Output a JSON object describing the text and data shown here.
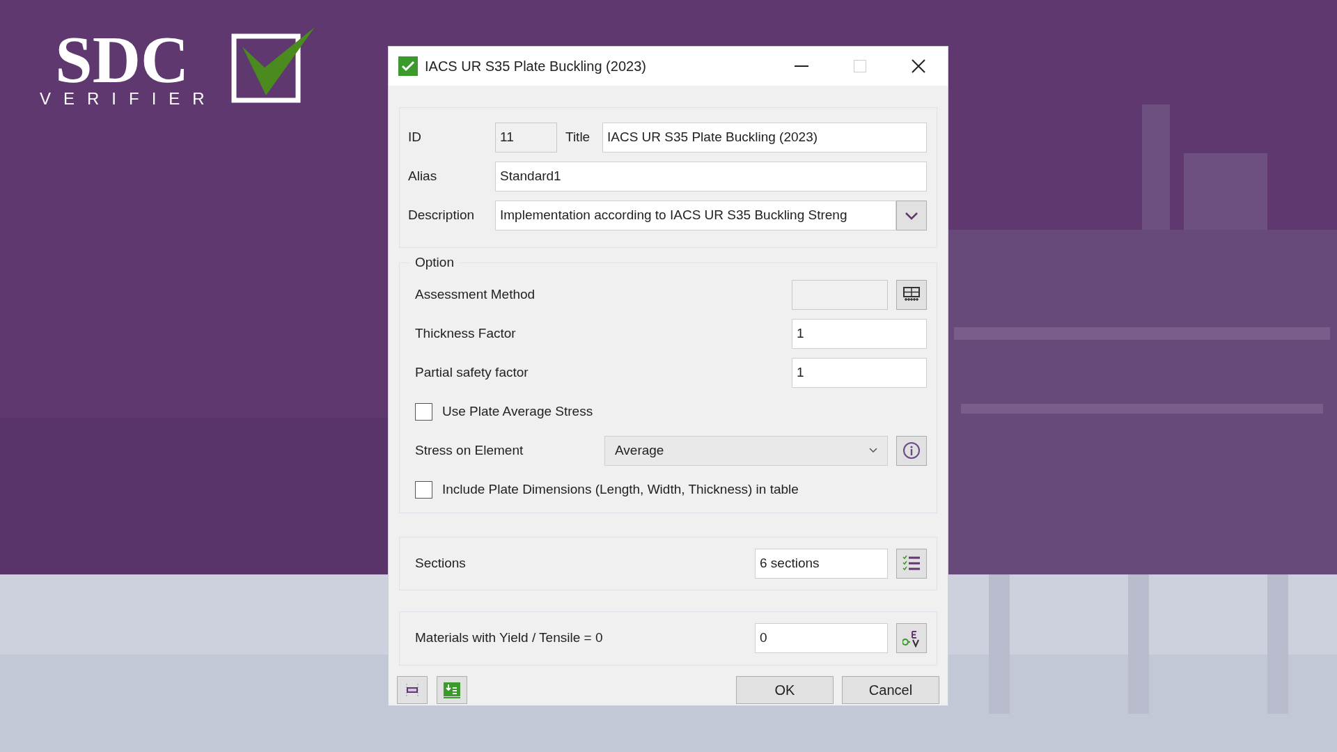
{
  "logo": {
    "name": "SDC",
    "tagline": "VERIFIER"
  },
  "window": {
    "title": "IACS UR S35 Plate Buckling (2023)"
  },
  "general": {
    "id": {
      "label": "ID",
      "value": "11",
      "disabled": true
    },
    "title": {
      "label": "Title",
      "value": "IACS UR S35 Plate Buckling (2023)"
    },
    "alias": {
      "label": "Alias",
      "value": "Standard1"
    },
    "description": {
      "label": "Description",
      "value": "Implementation according to IACS UR S35 Buckling Streng"
    }
  },
  "option": {
    "legend": "Option",
    "assessment_method": {
      "label": "Assessment Method",
      "disabled": true
    },
    "thickness_factor": {
      "label": "Thickness Factor",
      "value": "1"
    },
    "partial_safety_factor": {
      "label": "Partial safety factor",
      "value": "1"
    },
    "use_plate_average_stress": {
      "label": "Use Plate Average Stress",
      "checked": false
    },
    "stress_on_element": {
      "label": "Stress on Element",
      "value": "Average"
    },
    "include_plate_dimensions": {
      "label": "Include Plate Dimensions (Length, Width, Thickness) in table",
      "checked": false
    }
  },
  "sections": {
    "label": "Sections",
    "value": "6 sections"
  },
  "materials": {
    "label": "Materials with Yield / Tensile = 0",
    "value": "0"
  },
  "buttons": [
    {
      "label": "OK"
    },
    {
      "label": "Cancel"
    }
  ]
}
